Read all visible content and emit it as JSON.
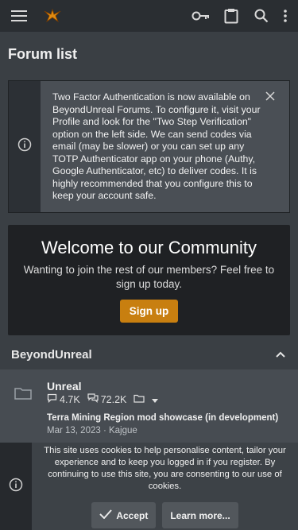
{
  "header": {
    "menu_icon": "hamburger-menu-icon",
    "logo_icon": "beyondunreal-logo-icon",
    "actions": [
      "key-icon",
      "clipboard-icon",
      "search-icon",
      "more-vertical-icon"
    ]
  },
  "page": {
    "title": "Forum list"
  },
  "notice": {
    "icon": "info-icon",
    "text": "Two Factor Authentication is now available on BeyondUnreal Forums. To configure it, visit your Profile and look for the \"Two Step Verification\" option on the left side. We can send codes via email (may be slower) or you can set up any TOTP Authenticator app on your phone (Authy, Google Authenticator, etc) to deliver codes. It is highly recommended that you configure this to keep your account safe."
  },
  "welcome": {
    "heading": "Welcome to our Community",
    "subtext": "Wanting to join the rest of our members? Feel free to sign up today.",
    "signup_label": "Sign up"
  },
  "category": {
    "title": "BeyondUnreal",
    "forums": [
      {
        "name": "Unreal",
        "threads": "4.7K",
        "messages": "72.2K",
        "latest_title": "Terra Mining Region mod showcase (in development)",
        "latest_date": "Mar 13, 2023",
        "latest_user": "Kajgue",
        "meta": "Mar 13, 2023 · Kajgue"
      }
    ]
  },
  "cookie": {
    "text": "This site uses cookies to help personalise content, tailor your experience and to keep you logged in if you register. By continuing to use this site, you are consenting to our use of cookies.",
    "accept_label": "Accept",
    "learn_more_label": "Learn more..."
  },
  "colors": {
    "accent": "#c87f10",
    "header_bg": "#2a2e32",
    "page_bg": "#3a3f44"
  }
}
